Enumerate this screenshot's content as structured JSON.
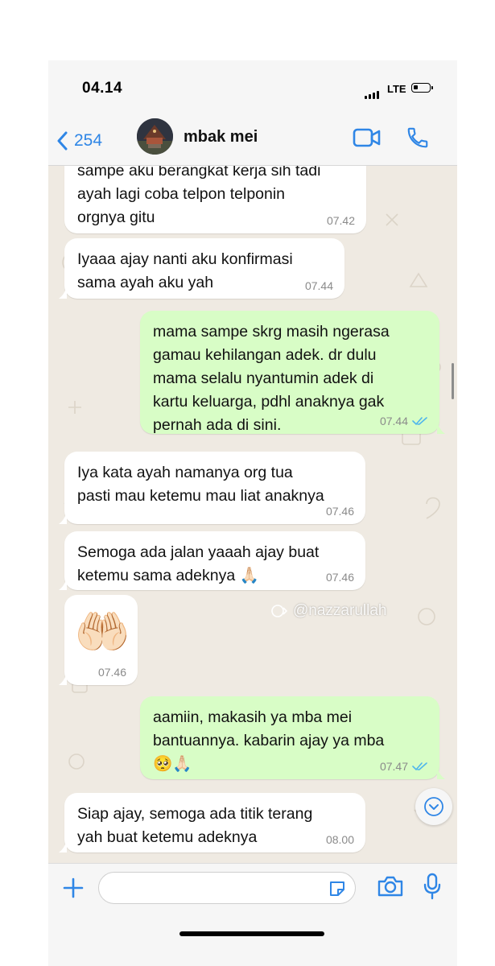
{
  "status": {
    "time": "04.14",
    "network": "LTE"
  },
  "header": {
    "back_count": "254",
    "contact_name": "mbak mei"
  },
  "messages": [
    {
      "text": "sampe aku berangkat kerja sih tadi\nayah lagi coba telpon telponin\norgnya gitu",
      "time": "07.42"
    },
    {
      "text": "Iyaaa ajay nanti aku konfirmasi\nsama ayah aku yah",
      "time": "07.44"
    },
    {
      "text": "mama sampe skrg masih ngerasa\ngamau kehilangan adek. dr dulu\nmama selalu nyantumin adek di\nkartu keluarga, pdhl anaknya gak\npernah ada di sini.",
      "time": "07.44"
    },
    {
      "text": "Iya kata ayah namanya org tua\npasti mau ketemu mau liat anaknya",
      "time": "07.46"
    },
    {
      "text": "Semoga ada jalan yaaah ajay buat\nketemu sama adeknya 🙏🏻",
      "time": "07.46"
    },
    {
      "text": "🤲🏻",
      "time": "07.46"
    },
    {
      "text": "aamiin, makasih ya mba mei\nbantuannya. kabarin ajay ya mba\n🥺🙏🏻",
      "time": "07.47"
    },
    {
      "text": "Siap ajay, semoga ada titik terang\nyah buat ketemu adeknya",
      "time": "08.00"
    }
  ],
  "watermark": "@nazzarullah",
  "colors": {
    "accent": "#2f86e6",
    "outgoing_bubble": "#d8fdc6",
    "incoming_bubble": "#ffffff",
    "chat_bg": "#efeae2",
    "read_tick": "#4fb6ec"
  },
  "icons": [
    "chevron-left-icon",
    "video-call-icon",
    "phone-icon",
    "plus-icon",
    "sticker-icon",
    "camera-icon",
    "mic-icon",
    "chevron-down-icon",
    "double-check-icon"
  ]
}
